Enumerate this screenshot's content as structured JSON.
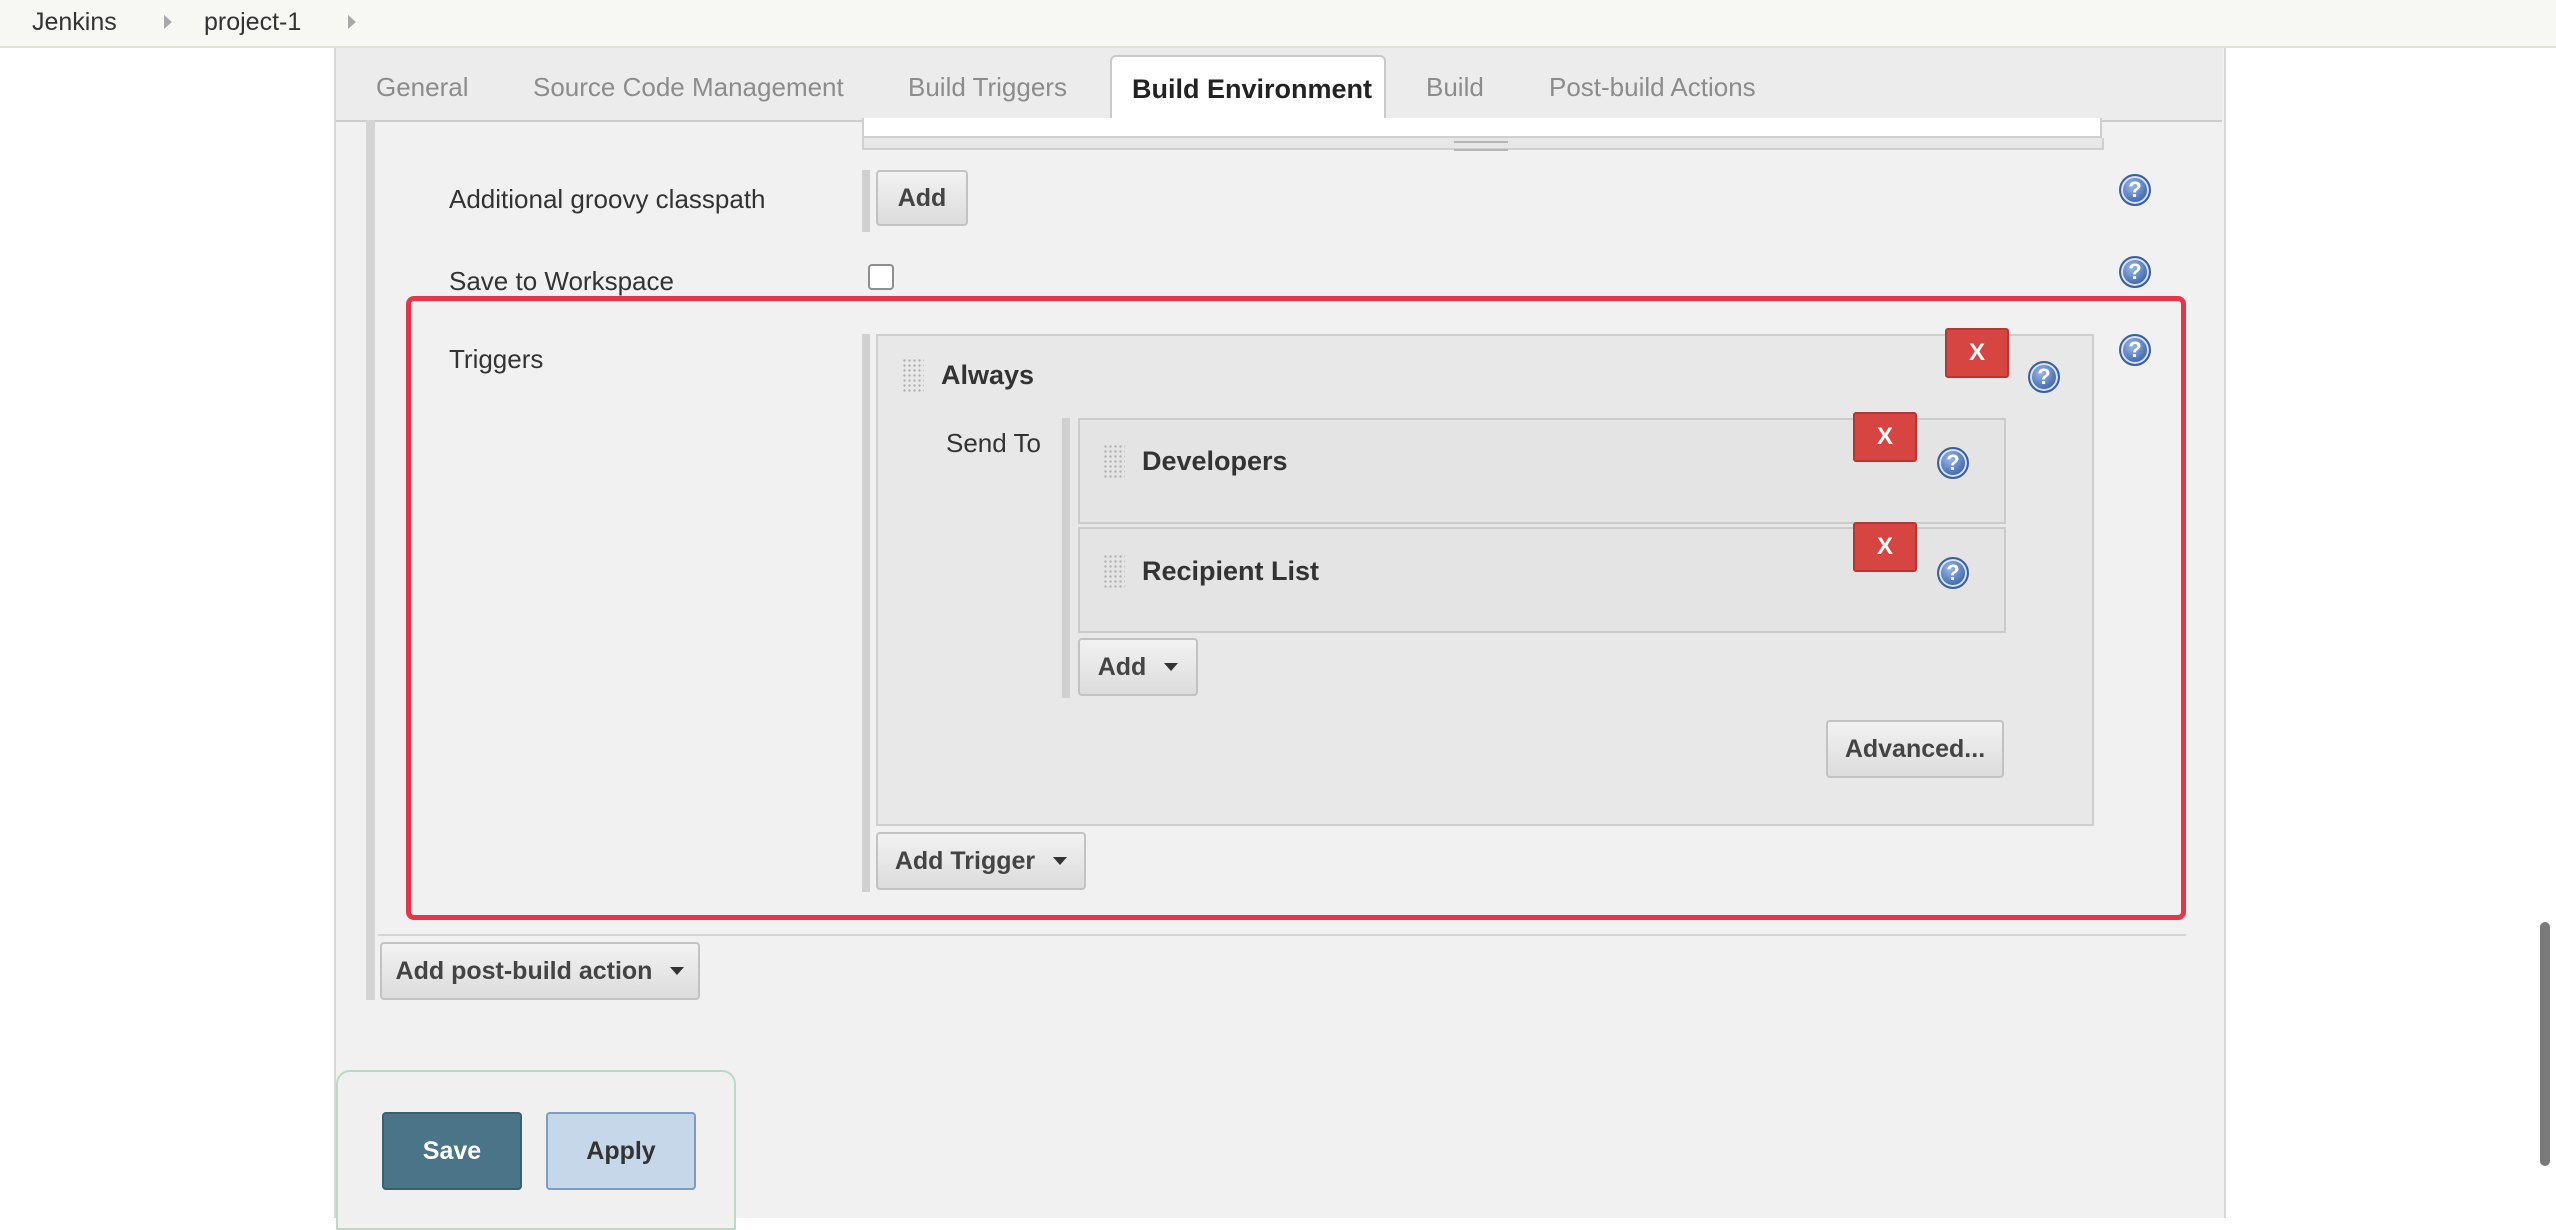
{
  "breadcrumb": {
    "items": [
      "Jenkins",
      "project-1"
    ]
  },
  "tabs": [
    "General",
    "Source Code Management",
    "Build Triggers",
    "Build Environment",
    "Build",
    "Post-build Actions"
  ],
  "active_tab": "Build Environment",
  "fields": {
    "groovy_classpath": {
      "label": "Additional groovy classpath",
      "button": "Add"
    },
    "save_workspace": {
      "label": "Save to Workspace",
      "checked": false
    },
    "triggers": {
      "label": "Triggers"
    }
  },
  "trigger": {
    "title": "Always",
    "remove_label": "X",
    "send_to_label": "Send To",
    "recipients": [
      {
        "title": "Developers",
        "remove_label": "X"
      },
      {
        "title": "Recipient List",
        "remove_label": "X"
      }
    ],
    "add_label": "Add",
    "advanced_label": "Advanced..."
  },
  "add_trigger_label": "Add Trigger",
  "add_post_build_label": "Add post-build action",
  "actions": {
    "save": "Save",
    "apply": "Apply"
  },
  "help_glyph": "?",
  "colors": {
    "highlight": "#e8334a",
    "remove": "#d64541",
    "save": "#4a7488",
    "apply": "#c7d7ea"
  }
}
